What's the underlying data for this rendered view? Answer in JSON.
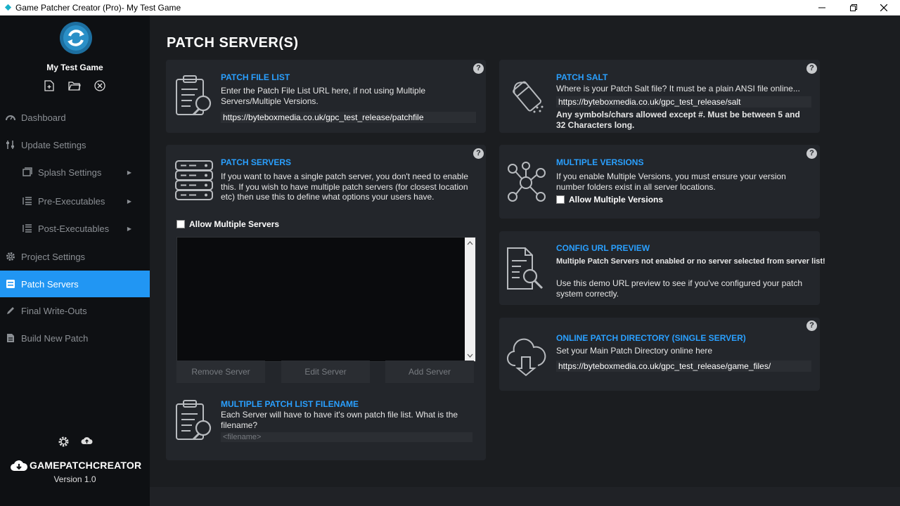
{
  "window": {
    "title": "Game Patcher Creator (Pro)- My Test Game"
  },
  "sidebar": {
    "project_name": "My Test Game",
    "nav": [
      {
        "label": "Dashboard",
        "icon": "speedometer-icon"
      },
      {
        "label": "Update Settings",
        "icon": "sliders-icon"
      },
      {
        "label": "Splash Settings",
        "icon": "window-icon"
      },
      {
        "label": "Pre-Executables",
        "icon": "list-icon"
      },
      {
        "label": "Post-Executables",
        "icon": "list-icon"
      },
      {
        "label": "Project Settings",
        "icon": "gear-icon"
      },
      {
        "label": "Patch Servers",
        "icon": "server-icon"
      },
      {
        "label": "Final Write-Outs",
        "icon": "pencil-icon"
      },
      {
        "label": "Build New Patch",
        "icon": "file-icon"
      }
    ],
    "brand": "GAMEPATCHCREATOR",
    "version": "Version 1.0"
  },
  "main": {
    "page_title": "PATCH SERVER(S)",
    "patch_file_list": {
      "title": "PATCH FILE LIST",
      "desc": "Enter the Patch File List URL here, if not using Multiple Servers/Multiple Versions.",
      "value": "https://byteboxmedia.co.uk/gpc_test_release/patchfile"
    },
    "patch_servers": {
      "title": "PATCH SERVERS",
      "desc": "If you want to have a single patch server, you don't need to enable this. If you wish to have multiple patch servers (for closest location etc) then use this to define what options your users have.",
      "checkbox_label": "Allow Multiple Servers",
      "remove_label": "Remove Server",
      "edit_label": "Edit Server",
      "add_label": "Add Server"
    },
    "multi_filename": {
      "title": "MULTIPLE PATCH LIST FILENAME",
      "desc": "Each Server will have to have it's own patch file list. What is the filename?",
      "placeholder": "<filename>"
    },
    "patch_salt": {
      "title": "PATCH SALT",
      "desc": "Where is your Patch Salt file? It must be a plain ANSI file online...",
      "value": "https://byteboxmedia.co.uk/gpc_test_release/salt",
      "warning": "Any symbols/chars allowed except #. Must be between 5 and 32 Characters long."
    },
    "multiple_versions": {
      "title": "MULTIPLE VERSIONS",
      "desc": "If you enable Multiple Versions, you must ensure your version number folders exist in all server locations.",
      "checkbox_label": "Allow Multiple Versions"
    },
    "config_preview": {
      "title": "CONFIG URL PREVIEW",
      "status": "Multiple Patch Servers not enabled or no server selected from server list!",
      "desc": "Use this demo URL preview to see if you've configured your patch system correctly."
    },
    "online_dir": {
      "title": "ONLINE PATCH DIRECTORY (SINGLE SERVER)",
      "desc": "Set your Main Patch Directory online here",
      "value": "https://byteboxmedia.co.uk/gpc_test_release/game_files/"
    },
    "help_label": "?"
  },
  "colors": {
    "accent": "#2196f3",
    "title_blue": "#2aa0ff",
    "warning": "#ff3b4e",
    "ok": "#39e639"
  }
}
